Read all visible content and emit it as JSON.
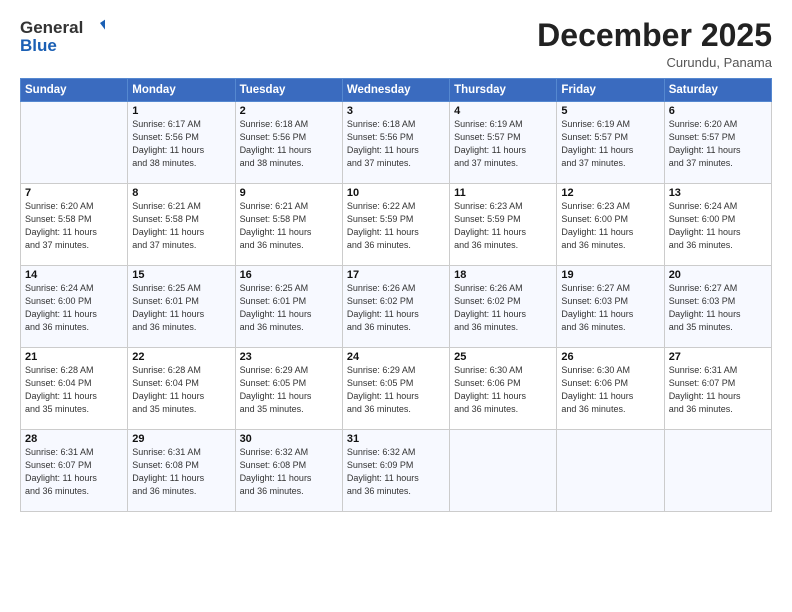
{
  "header": {
    "logo_line1": "General",
    "logo_line2": "Blue",
    "month": "December 2025",
    "location": "Curundu, Panama"
  },
  "weekdays": [
    "Sunday",
    "Monday",
    "Tuesday",
    "Wednesday",
    "Thursday",
    "Friday",
    "Saturday"
  ],
  "weeks": [
    [
      {
        "day": "",
        "info": ""
      },
      {
        "day": "1",
        "info": "Sunrise: 6:17 AM\nSunset: 5:56 PM\nDaylight: 11 hours\nand 38 minutes."
      },
      {
        "day": "2",
        "info": "Sunrise: 6:18 AM\nSunset: 5:56 PM\nDaylight: 11 hours\nand 38 minutes."
      },
      {
        "day": "3",
        "info": "Sunrise: 6:18 AM\nSunset: 5:56 PM\nDaylight: 11 hours\nand 37 minutes."
      },
      {
        "day": "4",
        "info": "Sunrise: 6:19 AM\nSunset: 5:57 PM\nDaylight: 11 hours\nand 37 minutes."
      },
      {
        "day": "5",
        "info": "Sunrise: 6:19 AM\nSunset: 5:57 PM\nDaylight: 11 hours\nand 37 minutes."
      },
      {
        "day": "6",
        "info": "Sunrise: 6:20 AM\nSunset: 5:57 PM\nDaylight: 11 hours\nand 37 minutes."
      }
    ],
    [
      {
        "day": "7",
        "info": "Sunrise: 6:20 AM\nSunset: 5:58 PM\nDaylight: 11 hours\nand 37 minutes."
      },
      {
        "day": "8",
        "info": "Sunrise: 6:21 AM\nSunset: 5:58 PM\nDaylight: 11 hours\nand 37 minutes."
      },
      {
        "day": "9",
        "info": "Sunrise: 6:21 AM\nSunset: 5:58 PM\nDaylight: 11 hours\nand 36 minutes."
      },
      {
        "day": "10",
        "info": "Sunrise: 6:22 AM\nSunset: 5:59 PM\nDaylight: 11 hours\nand 36 minutes."
      },
      {
        "day": "11",
        "info": "Sunrise: 6:23 AM\nSunset: 5:59 PM\nDaylight: 11 hours\nand 36 minutes."
      },
      {
        "day": "12",
        "info": "Sunrise: 6:23 AM\nSunset: 6:00 PM\nDaylight: 11 hours\nand 36 minutes."
      },
      {
        "day": "13",
        "info": "Sunrise: 6:24 AM\nSunset: 6:00 PM\nDaylight: 11 hours\nand 36 minutes."
      }
    ],
    [
      {
        "day": "14",
        "info": "Sunrise: 6:24 AM\nSunset: 6:00 PM\nDaylight: 11 hours\nand 36 minutes."
      },
      {
        "day": "15",
        "info": "Sunrise: 6:25 AM\nSunset: 6:01 PM\nDaylight: 11 hours\nand 36 minutes."
      },
      {
        "day": "16",
        "info": "Sunrise: 6:25 AM\nSunset: 6:01 PM\nDaylight: 11 hours\nand 36 minutes."
      },
      {
        "day": "17",
        "info": "Sunrise: 6:26 AM\nSunset: 6:02 PM\nDaylight: 11 hours\nand 36 minutes."
      },
      {
        "day": "18",
        "info": "Sunrise: 6:26 AM\nSunset: 6:02 PM\nDaylight: 11 hours\nand 36 minutes."
      },
      {
        "day": "19",
        "info": "Sunrise: 6:27 AM\nSunset: 6:03 PM\nDaylight: 11 hours\nand 36 minutes."
      },
      {
        "day": "20",
        "info": "Sunrise: 6:27 AM\nSunset: 6:03 PM\nDaylight: 11 hours\nand 35 minutes."
      }
    ],
    [
      {
        "day": "21",
        "info": "Sunrise: 6:28 AM\nSunset: 6:04 PM\nDaylight: 11 hours\nand 35 minutes."
      },
      {
        "day": "22",
        "info": "Sunrise: 6:28 AM\nSunset: 6:04 PM\nDaylight: 11 hours\nand 35 minutes."
      },
      {
        "day": "23",
        "info": "Sunrise: 6:29 AM\nSunset: 6:05 PM\nDaylight: 11 hours\nand 35 minutes."
      },
      {
        "day": "24",
        "info": "Sunrise: 6:29 AM\nSunset: 6:05 PM\nDaylight: 11 hours\nand 36 minutes."
      },
      {
        "day": "25",
        "info": "Sunrise: 6:30 AM\nSunset: 6:06 PM\nDaylight: 11 hours\nand 36 minutes."
      },
      {
        "day": "26",
        "info": "Sunrise: 6:30 AM\nSunset: 6:06 PM\nDaylight: 11 hours\nand 36 minutes."
      },
      {
        "day": "27",
        "info": "Sunrise: 6:31 AM\nSunset: 6:07 PM\nDaylight: 11 hours\nand 36 minutes."
      }
    ],
    [
      {
        "day": "28",
        "info": "Sunrise: 6:31 AM\nSunset: 6:07 PM\nDaylight: 11 hours\nand 36 minutes."
      },
      {
        "day": "29",
        "info": "Sunrise: 6:31 AM\nSunset: 6:08 PM\nDaylight: 11 hours\nand 36 minutes."
      },
      {
        "day": "30",
        "info": "Sunrise: 6:32 AM\nSunset: 6:08 PM\nDaylight: 11 hours\nand 36 minutes."
      },
      {
        "day": "31",
        "info": "Sunrise: 6:32 AM\nSunset: 6:09 PM\nDaylight: 11 hours\nand 36 minutes."
      },
      {
        "day": "",
        "info": ""
      },
      {
        "day": "",
        "info": ""
      },
      {
        "day": "",
        "info": ""
      }
    ]
  ]
}
